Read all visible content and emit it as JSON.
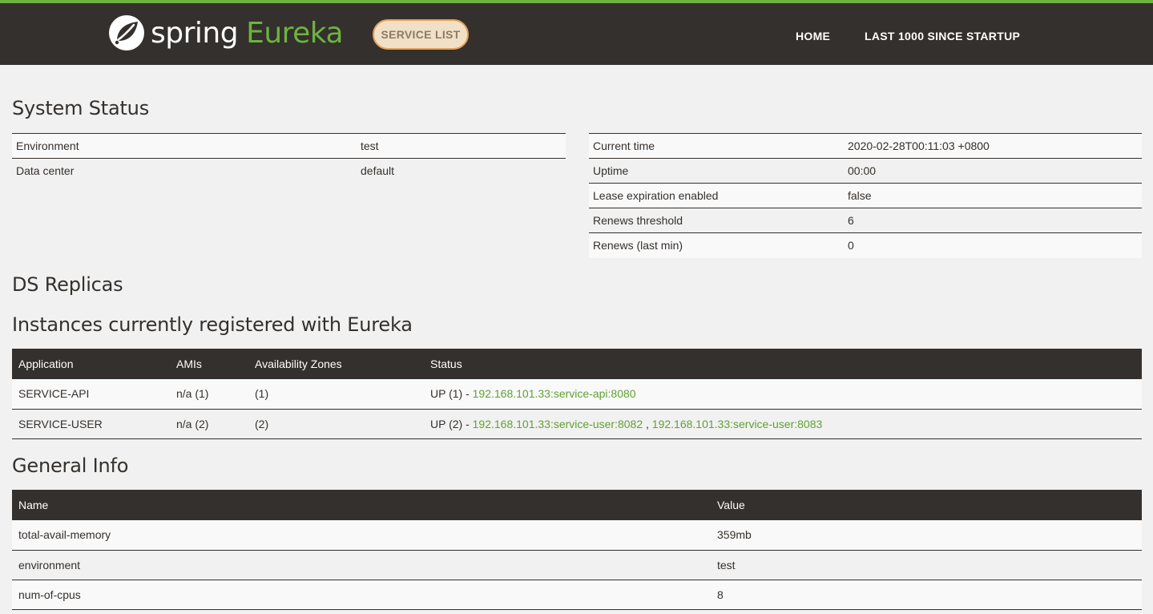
{
  "header": {
    "brand_spring": "spring",
    "brand_eureka": "Eureka",
    "service_list": "SERVICE LIST",
    "nav_home": "HOME",
    "nav_last": "LAST 1000 SINCE STARTUP",
    "colors": {
      "bar": "#34302d",
      "accent": "#6db33f"
    }
  },
  "system_status": {
    "title": "System Status",
    "left": [
      {
        "key": "Environment",
        "value": "test"
      },
      {
        "key": "Data center",
        "value": "default"
      }
    ],
    "right": [
      {
        "key": "Current time",
        "value": "2020-02-28T00:11:03 +0800"
      },
      {
        "key": "Uptime",
        "value": "00:00"
      },
      {
        "key": "Lease expiration enabled",
        "value": "false"
      },
      {
        "key": "Renews threshold",
        "value": "6"
      },
      {
        "key": "Renews (last min)",
        "value": "0"
      }
    ]
  },
  "ds_replicas": {
    "title": "DS Replicas"
  },
  "instances": {
    "title": "Instances currently registered with Eureka",
    "columns": [
      "Application",
      "AMIs",
      "Availability Zones",
      "Status"
    ],
    "rows": [
      {
        "application": "SERVICE-API",
        "amis": "n/a (1)",
        "zones": "(1)",
        "status_prefix": "UP (1) - ",
        "links": [
          "192.168.101.33:service-api:8080"
        ]
      },
      {
        "application": "SERVICE-USER",
        "amis": "n/a (2)",
        "zones": "(2)",
        "status_prefix": "UP (2) - ",
        "links": [
          "192.168.101.33:service-user:8082",
          "192.168.101.33:service-user:8083"
        ],
        "separator": " , "
      }
    ]
  },
  "general_info": {
    "title": "General Info",
    "columns": [
      "Name",
      "Value"
    ],
    "rows": [
      {
        "name": "total-avail-memory",
        "value": "359mb"
      },
      {
        "name": "environment",
        "value": "test"
      },
      {
        "name": "num-of-cpus",
        "value": "8"
      }
    ]
  }
}
